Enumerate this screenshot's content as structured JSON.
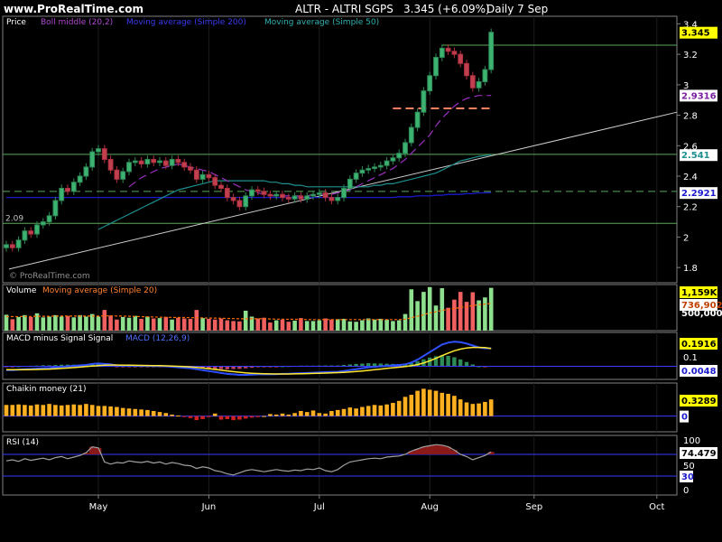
{
  "header": {
    "site": "www.ProRealTime.com",
    "symbol": "ALTR - ALTRI SGPS",
    "last": "3.345 (+6.09%)",
    "period": "Daily  7 Sep"
  },
  "colors": {
    "background": "#000000",
    "frame": "#808080",
    "grid": "#5e5e5e",
    "up_candle": "#2e8b57",
    "down_candle": "#b03040",
    "boll_middle": "#9b30c0",
    "ma200": "#1a1acd",
    "ma50": "#1f8f8f",
    "support_line": "#5aa85a",
    "trend_line": "#cccccc",
    "pink_dash": "#ff8060",
    "volume_bar": "#8ee08e",
    "volume_down_bar": "#f06060",
    "volume_ma": "#ff6a00",
    "macd_line": "#3050ff",
    "signal_line": "#ffe830",
    "histo_up": "#2e8b57",
    "histo_down": "#c04060",
    "chaikin_up": "#ffb020",
    "chaikin_down": "#d02020",
    "rsi_line": "#a0a0a0",
    "rsi_over": "#8a1a1a"
  },
  "chart_data": [
    {
      "type": "candlestick",
      "name": "Price",
      "legend": [
        "Price",
        "Boll middle (20,2)",
        "Moving average (Simple 200)",
        "Moving average (Simple 50)"
      ],
      "ylim": [
        1.7,
        3.45
      ],
      "y_ticks": [
        "3.4",
        "3.2",
        "3",
        "2.8",
        "2.6",
        "2.4",
        "2.2",
        "2",
        "1.8"
      ],
      "y_tick_values": [
        3.4,
        3.2,
        3.0,
        2.8,
        2.6,
        2.4,
        2.2,
        2.0,
        1.8
      ],
      "value_tags": [
        {
          "label": "3.345",
          "value": 3.345,
          "bg": "#ffff00",
          "fg": "#000000"
        },
        {
          "label": "2.9316",
          "value": 2.9316,
          "bg": "#ffffff",
          "fg": "#7a1fa0"
        },
        {
          "label": "2.541",
          "value": 2.541,
          "bg": "#ffffff",
          "fg": "#1f8f8f"
        },
        {
          "label": "2.2921",
          "value": 2.2921,
          "bg": "#ffffff",
          "fg": "#1a1acd"
        }
      ],
      "annotation": "2.09",
      "annotation_value": 2.09,
      "watermark": "© ProRealTime.com",
      "horizontal_lines": [
        2.543,
        2.09
      ],
      "dashed_line": 2.3,
      "close": [
        1.95,
        1.93,
        1.98,
        2.04,
        2.02,
        2.08,
        2.1,
        2.14,
        2.24,
        2.32,
        2.3,
        2.36,
        2.4,
        2.46,
        2.56,
        2.58,
        2.51,
        2.44,
        2.38,
        2.43,
        2.49,
        2.5,
        2.48,
        2.51,
        2.49,
        2.5,
        2.47,
        2.51,
        2.49,
        2.46,
        2.44,
        2.38,
        2.41,
        2.39,
        2.34,
        2.32,
        2.26,
        2.24,
        2.2,
        2.27,
        2.31,
        2.3,
        2.28,
        2.27,
        2.28,
        2.26,
        2.25,
        2.27,
        2.25,
        2.27,
        2.28,
        2.29,
        2.26,
        2.24,
        2.26,
        2.32,
        2.38,
        2.42,
        2.44,
        2.45,
        2.46,
        2.47,
        2.5,
        2.52,
        2.55,
        2.62,
        2.72,
        2.82,
        2.96,
        3.06,
        3.18,
        3.24,
        3.22,
        3.2,
        3.14,
        3.06,
        2.98,
        3.02,
        3.1,
        3.345
      ],
      "boll_middle": [
        null,
        null,
        null,
        null,
        null,
        null,
        null,
        null,
        null,
        null,
        null,
        null,
        null,
        null,
        null,
        null,
        null,
        null,
        null,
        null,
        2.33,
        2.36,
        2.39,
        2.41,
        2.43,
        2.45,
        2.46,
        2.47,
        2.48,
        2.47,
        2.46,
        2.45,
        2.44,
        2.43,
        2.41,
        2.39,
        2.37,
        2.35,
        2.33,
        2.31,
        2.3,
        2.29,
        2.28,
        2.27,
        2.27,
        2.27,
        2.27,
        2.27,
        2.27,
        2.27,
        2.28,
        2.28,
        2.28,
        2.28,
        2.29,
        2.3,
        2.31,
        2.33,
        2.35,
        2.37,
        2.39,
        2.41,
        2.43,
        2.45,
        2.48,
        2.51,
        2.55,
        2.59,
        2.63,
        2.67,
        2.73,
        2.78,
        2.82,
        2.86,
        2.89,
        2.91,
        2.92,
        2.93,
        2.93,
        2.93
      ],
      "ma200": [
        2.26,
        2.26,
        2.26,
        2.26,
        2.26,
        2.26,
        2.26,
        2.26,
        2.26,
        2.26,
        2.26,
        2.26,
        2.26,
        2.26,
        2.26,
        2.26,
        2.26,
        2.26,
        2.26,
        2.26,
        2.26,
        2.26,
        2.26,
        2.26,
        2.26,
        2.26,
        2.26,
        2.26,
        2.26,
        2.26,
        2.26,
        2.26,
        2.26,
        2.26,
        2.26,
        2.26,
        2.26,
        2.26,
        2.26,
        2.26,
        2.26,
        2.26,
        2.26,
        2.26,
        2.26,
        2.26,
        2.26,
        2.26,
        2.26,
        2.26,
        2.26,
        2.26,
        2.26,
        2.26,
        2.26,
        2.26,
        2.26,
        2.26,
        2.26,
        2.26,
        2.26,
        2.26,
        2.26,
        2.26,
        2.265,
        2.265,
        2.265,
        2.27,
        2.27,
        2.27,
        2.275,
        2.275,
        2.28,
        2.28,
        2.28,
        2.285,
        2.285,
        2.29,
        2.29,
        2.292
      ],
      "ma50": [
        null,
        null,
        null,
        null,
        null,
        null,
        null,
        null,
        null,
        null,
        null,
        null,
        null,
        null,
        null,
        2.05,
        2.07,
        2.09,
        2.11,
        2.13,
        2.15,
        2.17,
        2.19,
        2.21,
        2.23,
        2.25,
        2.27,
        2.29,
        2.31,
        2.32,
        2.33,
        2.34,
        2.35,
        2.36,
        2.37,
        2.37,
        2.37,
        2.37,
        2.37,
        2.37,
        2.37,
        2.37,
        2.37,
        2.36,
        2.36,
        2.35,
        2.35,
        2.34,
        2.34,
        2.33,
        2.33,
        2.33,
        2.33,
        2.33,
        2.33,
        2.33,
        2.33,
        2.33,
        2.33,
        2.33,
        2.34,
        2.34,
        2.35,
        2.35,
        2.36,
        2.37,
        2.38,
        2.39,
        2.4,
        2.41,
        2.42,
        2.44,
        2.46,
        2.48,
        2.5,
        2.51,
        2.52,
        2.53,
        2.535,
        2.541
      ]
    },
    {
      "type": "bar",
      "name": "Volume",
      "legend": [
        "Volume",
        "Moving average (Simple 20)"
      ],
      "value_tags": [
        {
          "label": "1,159K",
          "bg": "#ffff00",
          "fg": "#000000"
        },
        {
          "label": "736,902",
          "bg": "#ffffff",
          "fg": "#c04000"
        },
        {
          "label": "500,000",
          "bg": "#000000",
          "fg": "#ffffff"
        }
      ],
      "ymax": 1200,
      "units": "thousands",
      "values": [
        430,
        310,
        370,
        420,
        370,
        470,
        360,
        380,
        420,
        380,
        400,
        360,
        420,
        380,
        450,
        380,
        560,
        410,
        300,
        370,
        350,
        400,
        320,
        380,
        330,
        340,
        370,
        300,
        350,
        330,
        320,
        560,
        340,
        320,
        300,
        330,
        280,
        260,
        250,
        540,
        380,
        330,
        350,
        220,
        280,
        300,
        240,
        270,
        340,
        260,
        260,
        280,
        330,
        300,
        310,
        320,
        250,
        240,
        280,
        330,
        300,
        320,
        300,
        260,
        280,
        450,
        1120,
        800,
        1050,
        1180,
        680,
        1150,
        620,
        840,
        1050,
        780,
        1040,
        820,
        900,
        1159
      ],
      "ma": [
        380,
        380,
        380,
        385,
        385,
        390,
        390,
        390,
        395,
        395,
        395,
        395,
        395,
        395,
        395,
        395,
        400,
        400,
        395,
        395,
        390,
        385,
        380,
        375,
        370,
        365,
        360,
        360,
        355,
        355,
        350,
        350,
        345,
        340,
        340,
        335,
        330,
        325,
        320,
        320,
        320,
        320,
        320,
        315,
        310,
        310,
        305,
        305,
        305,
        300,
        300,
        300,
        300,
        300,
        300,
        300,
        300,
        300,
        300,
        300,
        300,
        300,
        300,
        300,
        300,
        310,
        350,
        390,
        430,
        480,
        510,
        550,
        570,
        600,
        630,
        650,
        680,
        700,
        720,
        737
      ]
    },
    {
      "type": "line",
      "name": "MACD",
      "legend": [
        "MACD minus Signal Signal",
        "MACD (12,26,9)"
      ],
      "value_tags": [
        {
          "label": "0.1916",
          "bg": "#ffff00",
          "fg": "#000000"
        },
        {
          "label": "0.0048",
          "bg": "#ffffff",
          "fg": "#1a1acd"
        }
      ],
      "y_ticks": [
        "0.1",
        "0"
      ],
      "y_tick_values": [
        0.1,
        0.0
      ],
      "ylim": [
        -0.1,
        0.32
      ],
      "macd": [
        -0.04,
        -0.04,
        -0.035,
        -0.03,
        -0.028,
        -0.025,
        -0.02,
        -0.018,
        -0.012,
        -0.005,
        0.0,
        0.005,
        0.01,
        0.015,
        0.025,
        0.03,
        0.025,
        0.02,
        0.01,
        0.005,
        0.005,
        0.005,
        0.004,
        0.004,
        0.003,
        0.002,
        0.0,
        -0.005,
        -0.01,
        -0.015,
        -0.02,
        -0.03,
        -0.04,
        -0.05,
        -0.06,
        -0.07,
        -0.08,
        -0.085,
        -0.09,
        -0.09,
        -0.088,
        -0.085,
        -0.085,
        -0.085,
        -0.083,
        -0.08,
        -0.078,
        -0.075,
        -0.072,
        -0.07,
        -0.068,
        -0.065,
        -0.062,
        -0.06,
        -0.058,
        -0.05,
        -0.04,
        -0.03,
        -0.02,
        -0.01,
        -0.005,
        0.0,
        0.005,
        0.01,
        0.015,
        0.02,
        0.04,
        0.07,
        0.11,
        0.15,
        0.19,
        0.23,
        0.25,
        0.26,
        0.255,
        0.24,
        0.22,
        0.2,
        0.19,
        0.1916
      ],
      "signal": [
        -0.035,
        -0.036,
        -0.036,
        -0.035,
        -0.034,
        -0.033,
        -0.031,
        -0.029,
        -0.026,
        -0.022,
        -0.018,
        -0.013,
        -0.008,
        -0.003,
        0.003,
        0.008,
        0.012,
        0.014,
        0.014,
        0.013,
        0.012,
        0.011,
        0.01,
        0.009,
        0.008,
        0.007,
        0.005,
        0.003,
        0.0,
        -0.003,
        -0.007,
        -0.012,
        -0.018,
        -0.025,
        -0.032,
        -0.04,
        -0.048,
        -0.056,
        -0.063,
        -0.069,
        -0.073,
        -0.076,
        -0.078,
        -0.08,
        -0.081,
        -0.081,
        -0.081,
        -0.08,
        -0.079,
        -0.077,
        -0.075,
        -0.073,
        -0.071,
        -0.069,
        -0.067,
        -0.064,
        -0.06,
        -0.055,
        -0.049,
        -0.043,
        -0.036,
        -0.029,
        -0.022,
        -0.015,
        -0.009,
        -0.003,
        0.006,
        0.018,
        0.036,
        0.058,
        0.084,
        0.113,
        0.14,
        0.164,
        0.182,
        0.194,
        0.2,
        0.2,
        0.198,
        0.187
      ],
      "histogram": [
        -0.005,
        -0.004,
        0.001,
        0.005,
        0.006,
        0.008,
        0.011,
        0.011,
        0.014,
        0.017,
        0.018,
        0.018,
        0.018,
        0.018,
        0.022,
        0.022,
        0.013,
        0.006,
        -0.004,
        -0.008,
        -0.007,
        -0.006,
        -0.006,
        -0.005,
        -0.005,
        -0.005,
        -0.005,
        -0.008,
        -0.01,
        -0.012,
        -0.013,
        -0.018,
        -0.022,
        -0.025,
        -0.028,
        -0.03,
        -0.032,
        -0.029,
        -0.027,
        -0.021,
        -0.015,
        -0.009,
        -0.007,
        -0.005,
        -0.002,
        0.001,
        0.003,
        0.005,
        0.007,
        0.007,
        0.007,
        0.008,
        0.009,
        0.009,
        0.009,
        0.014,
        0.02,
        0.025,
        0.029,
        0.033,
        0.031,
        0.029,
        0.027,
        0.025,
        0.024,
        0.023,
        0.034,
        0.052,
        0.074,
        0.092,
        0.106,
        0.117,
        0.11,
        0.096,
        0.073,
        0.046,
        0.02,
        0.0,
        -0.008,
        0.0048
      ]
    },
    {
      "type": "bar",
      "name": "Chaikin",
      "legend": [
        "Chaikin money (21)"
      ],
      "value_tags": [
        {
          "label": "0.3289",
          "bg": "#ffff00",
          "fg": "#000000"
        },
        {
          "label": "0",
          "bg": "#ffffff",
          "fg": "#1a1acd"
        }
      ],
      "ylim": [
        -0.15,
        0.6
      ],
      "values": [
        0.22,
        0.22,
        0.23,
        0.22,
        0.21,
        0.23,
        0.22,
        0.24,
        0.22,
        0.21,
        0.22,
        0.23,
        0.22,
        0.24,
        0.22,
        0.2,
        0.2,
        0.19,
        0.18,
        0.16,
        0.15,
        0.14,
        0.13,
        0.12,
        0.1,
        0.08,
        0.06,
        0.03,
        0.01,
        -0.02,
        -0.04,
        -0.08,
        -0.06,
        -0.02,
        0.05,
        -0.07,
        -0.06,
        -0.08,
        -0.07,
        -0.05,
        -0.03,
        -0.02,
        0.0,
        0.04,
        0.03,
        0.05,
        0.03,
        0.06,
        0.1,
        0.08,
        0.11,
        0.06,
        0.05,
        0.1,
        0.12,
        0.14,
        0.17,
        0.15,
        0.18,
        0.2,
        0.22,
        0.21,
        0.23,
        0.26,
        0.3,
        0.38,
        0.42,
        0.5,
        0.54,
        0.52,
        0.5,
        0.46,
        0.44,
        0.4,
        0.33,
        0.27,
        0.24,
        0.25,
        0.28,
        0.3289
      ]
    },
    {
      "type": "line",
      "name": "RSI",
      "legend": [
        "RSI (14)"
      ],
      "value_tags": [
        {
          "label": "74.479",
          "bg": "#ffffff",
          "fg": "#000000"
        },
        {
          "label": "30",
          "bg": "#ffffff",
          "fg": "#1a1acd"
        }
      ],
      "y_ticks": [
        "100",
        "70",
        "50",
        "30",
        "0"
      ],
      "y_tick_values": [
        100,
        70,
        50,
        30,
        0
      ],
      "ylim": [
        0,
        100
      ],
      "values": [
        58,
        60,
        57,
        62,
        59,
        61,
        63,
        60,
        64,
        66,
        62,
        65,
        68,
        73,
        84,
        82,
        56,
        52,
        55,
        54,
        58,
        56,
        55,
        57,
        54,
        56,
        52,
        55,
        53,
        50,
        49,
        44,
        47,
        45,
        40,
        38,
        34,
        32,
        36,
        40,
        42,
        40,
        38,
        40,
        42,
        40,
        39,
        41,
        40,
        43,
        42,
        45,
        40,
        38,
        42,
        50,
        56,
        58,
        60,
        62,
        63,
        62,
        65,
        66,
        67,
        70,
        76,
        80,
        84,
        86,
        88,
        87,
        84,
        78,
        70,
        66,
        60,
        64,
        68,
        74.479
      ]
    }
  ],
  "x_axis": {
    "labels": [
      "May",
      "Jun",
      "Jul",
      "Aug",
      "Sep",
      "Oct"
    ],
    "label_index": [
      15,
      33,
      51,
      69,
      86,
      106
    ]
  }
}
